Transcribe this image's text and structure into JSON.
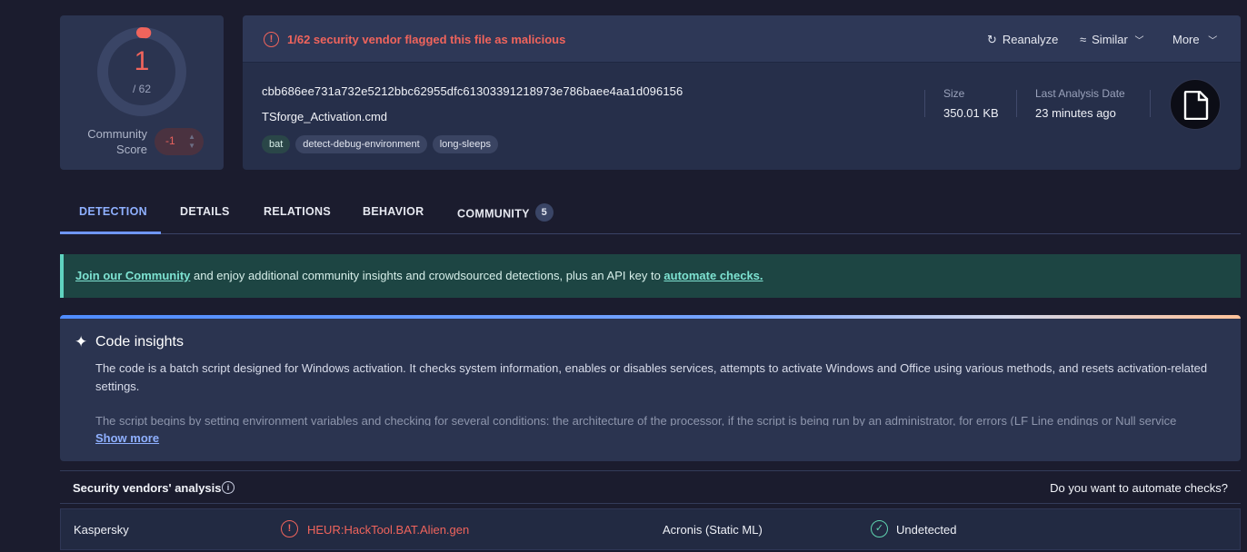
{
  "score": {
    "detections": "1",
    "total": "/ 62",
    "community_label_line1": "Community",
    "community_label_line2": "Score",
    "community_value": "-1"
  },
  "alert": {
    "text": "1/62 security vendor flagged this file as malicious",
    "icon": "alert-circle-icon",
    "color": "#f0645c"
  },
  "actions": {
    "reanalyze": "Reanalyze",
    "similar": "Similar",
    "more": "More"
  },
  "file": {
    "hash": "cbb686ee731a732e5212bbc62955dfc61303391218973e786baee4aa1d096156",
    "name": "TSforge_Activation.cmd",
    "tags": [
      "bat",
      "detect-debug-environment",
      "long-sleeps"
    ],
    "size_label": "Size",
    "size_value": "350.01 KB",
    "analysis_label": "Last Analysis Date",
    "analysis_value": "23 minutes ago",
    "file_icon": "document-icon"
  },
  "tabs": [
    {
      "label": "DETECTION",
      "active": true
    },
    {
      "label": "DETAILS"
    },
    {
      "label": "RELATIONS"
    },
    {
      "label": "BEHAVIOR"
    },
    {
      "label": "COMMUNITY",
      "badge": "5"
    }
  ],
  "banner": {
    "link1": "Join our Community",
    "middle": " and enjoy additional community insights and crowdsourced detections, plus an API key to ",
    "link2": "automate checks."
  },
  "insights": {
    "title": "Code insights",
    "paragraph1": "The code is a batch script designed for Windows activation. It checks system information, enables or disables services, attempts to activate Windows and Office using various methods, and resets activation-related settings.",
    "paragraph2": "The script begins by setting environment variables and checking for several conditions: the architecture of the processor, if the script is being run by an administrator, for errors (LF Line endings or Null service",
    "show_more": "Show more"
  },
  "vendors": {
    "title": "Security vendors' analysis",
    "automate_prompt": "Do you want to automate checks?",
    "rows": [
      {
        "vendor1": "Kaspersky",
        "result1": "HEUR:HackTool.BAT.Alien.gen",
        "vendor2": "Acronis (Static ML)",
        "result2": "Undetected"
      }
    ]
  },
  "colors": {
    "malicious": "#f0645c",
    "undetected": "#5fd3b0",
    "accent": "#8fb0ff"
  }
}
